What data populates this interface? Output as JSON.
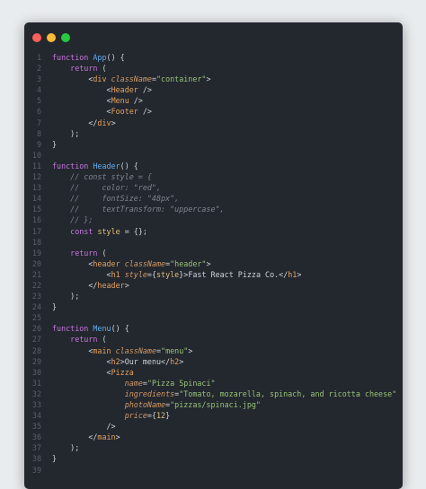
{
  "window": {
    "title_dots": [
      "close",
      "minimize",
      "maximize"
    ],
    "colors": {
      "background": "#23272e",
      "close": "#ff5f57",
      "minimize": "#febc2e",
      "maximize": "#28c840"
    }
  },
  "code_lines": [
    {
      "n": "1",
      "tokens": [
        [
          "kw",
          "function "
        ],
        [
          "fn",
          "App"
        ],
        [
          "pn",
          "() {"
        ]
      ]
    },
    {
      "n": "2",
      "tokens": [
        [
          "pn",
          "    "
        ],
        [
          "kw",
          "return"
        ],
        [
          "pn",
          " ("
        ]
      ]
    },
    {
      "n": "3",
      "tokens": [
        [
          "pn",
          "        <"
        ],
        [
          "tag",
          "div"
        ],
        [
          "pn",
          " "
        ],
        [
          "attr",
          "className"
        ],
        [
          "pn",
          "="
        ],
        [
          "str",
          "\"container\""
        ],
        [
          "pn",
          ">"
        ]
      ]
    },
    {
      "n": "4",
      "tokens": [
        [
          "pn",
          "            <"
        ],
        [
          "tag",
          "Header"
        ],
        [
          "pn",
          " />"
        ]
      ]
    },
    {
      "n": "5",
      "tokens": [
        [
          "pn",
          "            <"
        ],
        [
          "tag",
          "Menu"
        ],
        [
          "pn",
          " />"
        ]
      ]
    },
    {
      "n": "6",
      "tokens": [
        [
          "pn",
          "            <"
        ],
        [
          "tag",
          "Footer"
        ],
        [
          "pn",
          " />"
        ]
      ]
    },
    {
      "n": "7",
      "tokens": [
        [
          "pn",
          "        </"
        ],
        [
          "tag",
          "div"
        ],
        [
          "pn",
          ">"
        ]
      ]
    },
    {
      "n": "8",
      "tokens": [
        [
          "pn",
          "    );"
        ]
      ]
    },
    {
      "n": "9",
      "tokens": [
        [
          "pn",
          "}"
        ]
      ]
    },
    {
      "n": "10",
      "tokens": []
    },
    {
      "n": "11",
      "tokens": [
        [
          "kw",
          "function "
        ],
        [
          "fn",
          "Header"
        ],
        [
          "pn",
          "() {"
        ]
      ]
    },
    {
      "n": "12",
      "tokens": [
        [
          "cm",
          "    // const style = {"
        ]
      ]
    },
    {
      "n": "13",
      "tokens": [
        [
          "cm",
          "    //     color: \"red\","
        ]
      ]
    },
    {
      "n": "14",
      "tokens": [
        [
          "cm",
          "    //     fontSize: \"48px\","
        ]
      ]
    },
    {
      "n": "15",
      "tokens": [
        [
          "cm",
          "    //     textTransform: \"uppercase\","
        ]
      ]
    },
    {
      "n": "16",
      "tokens": [
        [
          "cm",
          "    // };"
        ]
      ]
    },
    {
      "n": "17",
      "tokens": [
        [
          "pn",
          "    "
        ],
        [
          "kw",
          "const "
        ],
        [
          "var",
          "style"
        ],
        [
          "pn",
          " = {};"
        ]
      ]
    },
    {
      "n": "18",
      "tokens": []
    },
    {
      "n": "19",
      "tokens": [
        [
          "pn",
          "    "
        ],
        [
          "kw",
          "return"
        ],
        [
          "pn",
          " ("
        ]
      ]
    },
    {
      "n": "20",
      "tokens": [
        [
          "pn",
          "        <"
        ],
        [
          "tag",
          "header"
        ],
        [
          "pn",
          " "
        ],
        [
          "attr",
          "className"
        ],
        [
          "pn",
          "="
        ],
        [
          "str",
          "\"header\""
        ],
        [
          "pn",
          ">"
        ]
      ]
    },
    {
      "n": "21",
      "tokens": [
        [
          "pn",
          "            <"
        ],
        [
          "tag",
          "h1"
        ],
        [
          "pn",
          " "
        ],
        [
          "attr",
          "style"
        ],
        [
          "pn",
          "={"
        ],
        [
          "var",
          "style"
        ],
        [
          "pn",
          "}>Fast React Pizza Co.</"
        ],
        [
          "tag",
          "h1"
        ],
        [
          "pn",
          ">"
        ]
      ]
    },
    {
      "n": "22",
      "tokens": [
        [
          "pn",
          "        </"
        ],
        [
          "tag",
          "header"
        ],
        [
          "pn",
          ">"
        ]
      ]
    },
    {
      "n": "23",
      "tokens": [
        [
          "pn",
          "    );"
        ]
      ]
    },
    {
      "n": "24",
      "tokens": [
        [
          "pn",
          "}"
        ]
      ]
    },
    {
      "n": "25",
      "tokens": []
    },
    {
      "n": "26",
      "tokens": [
        [
          "kw",
          "function "
        ],
        [
          "fn",
          "Menu"
        ],
        [
          "pn",
          "() {"
        ]
      ]
    },
    {
      "n": "27",
      "tokens": [
        [
          "pn",
          "    "
        ],
        [
          "kw",
          "return"
        ],
        [
          "pn",
          " ("
        ]
      ]
    },
    {
      "n": "28",
      "tokens": [
        [
          "pn",
          "        <"
        ],
        [
          "tag",
          "main"
        ],
        [
          "pn",
          " "
        ],
        [
          "attr",
          "className"
        ],
        [
          "pn",
          "="
        ],
        [
          "str",
          "\"menu\""
        ],
        [
          "pn",
          ">"
        ]
      ]
    },
    {
      "n": "29",
      "tokens": [
        [
          "pn",
          "            <"
        ],
        [
          "tag",
          "h2"
        ],
        [
          "pn",
          ">Our menu</"
        ],
        [
          "tag",
          "h2"
        ],
        [
          "pn",
          ">"
        ]
      ]
    },
    {
      "n": "30",
      "tokens": [
        [
          "pn",
          "            <"
        ],
        [
          "tag",
          "Pizza"
        ]
      ]
    },
    {
      "n": "31",
      "tokens": [
        [
          "pn",
          "                "
        ],
        [
          "attr",
          "name"
        ],
        [
          "pn",
          "="
        ],
        [
          "str",
          "\"Pizza Spinaci\""
        ]
      ]
    },
    {
      "n": "32",
      "tokens": [
        [
          "pn",
          "                "
        ],
        [
          "attr",
          "ingredients"
        ],
        [
          "pn",
          "="
        ],
        [
          "str",
          "\"Tomato, mozarella, spinach, and ricotta cheese\""
        ]
      ]
    },
    {
      "n": "33",
      "tokens": [
        [
          "pn",
          "                "
        ],
        [
          "attr",
          "photoName"
        ],
        [
          "pn",
          "="
        ],
        [
          "str",
          "\"pizzas/spinaci.jpg\""
        ]
      ]
    },
    {
      "n": "34",
      "tokens": [
        [
          "pn",
          "                "
        ],
        [
          "attr",
          "price"
        ],
        [
          "pn",
          "={"
        ],
        [
          "var",
          "12"
        ],
        [
          "pn",
          "}"
        ]
      ]
    },
    {
      "n": "35",
      "tokens": [
        [
          "pn",
          "            />"
        ]
      ]
    },
    {
      "n": "36",
      "tokens": [
        [
          "pn",
          "        </"
        ],
        [
          "tag",
          "main"
        ],
        [
          "pn",
          ">"
        ]
      ]
    },
    {
      "n": "37",
      "tokens": [
        [
          "pn",
          "    );"
        ]
      ]
    },
    {
      "n": "38",
      "tokens": [
        [
          "pn",
          "}"
        ]
      ]
    },
    {
      "n": "39",
      "tokens": []
    }
  ]
}
